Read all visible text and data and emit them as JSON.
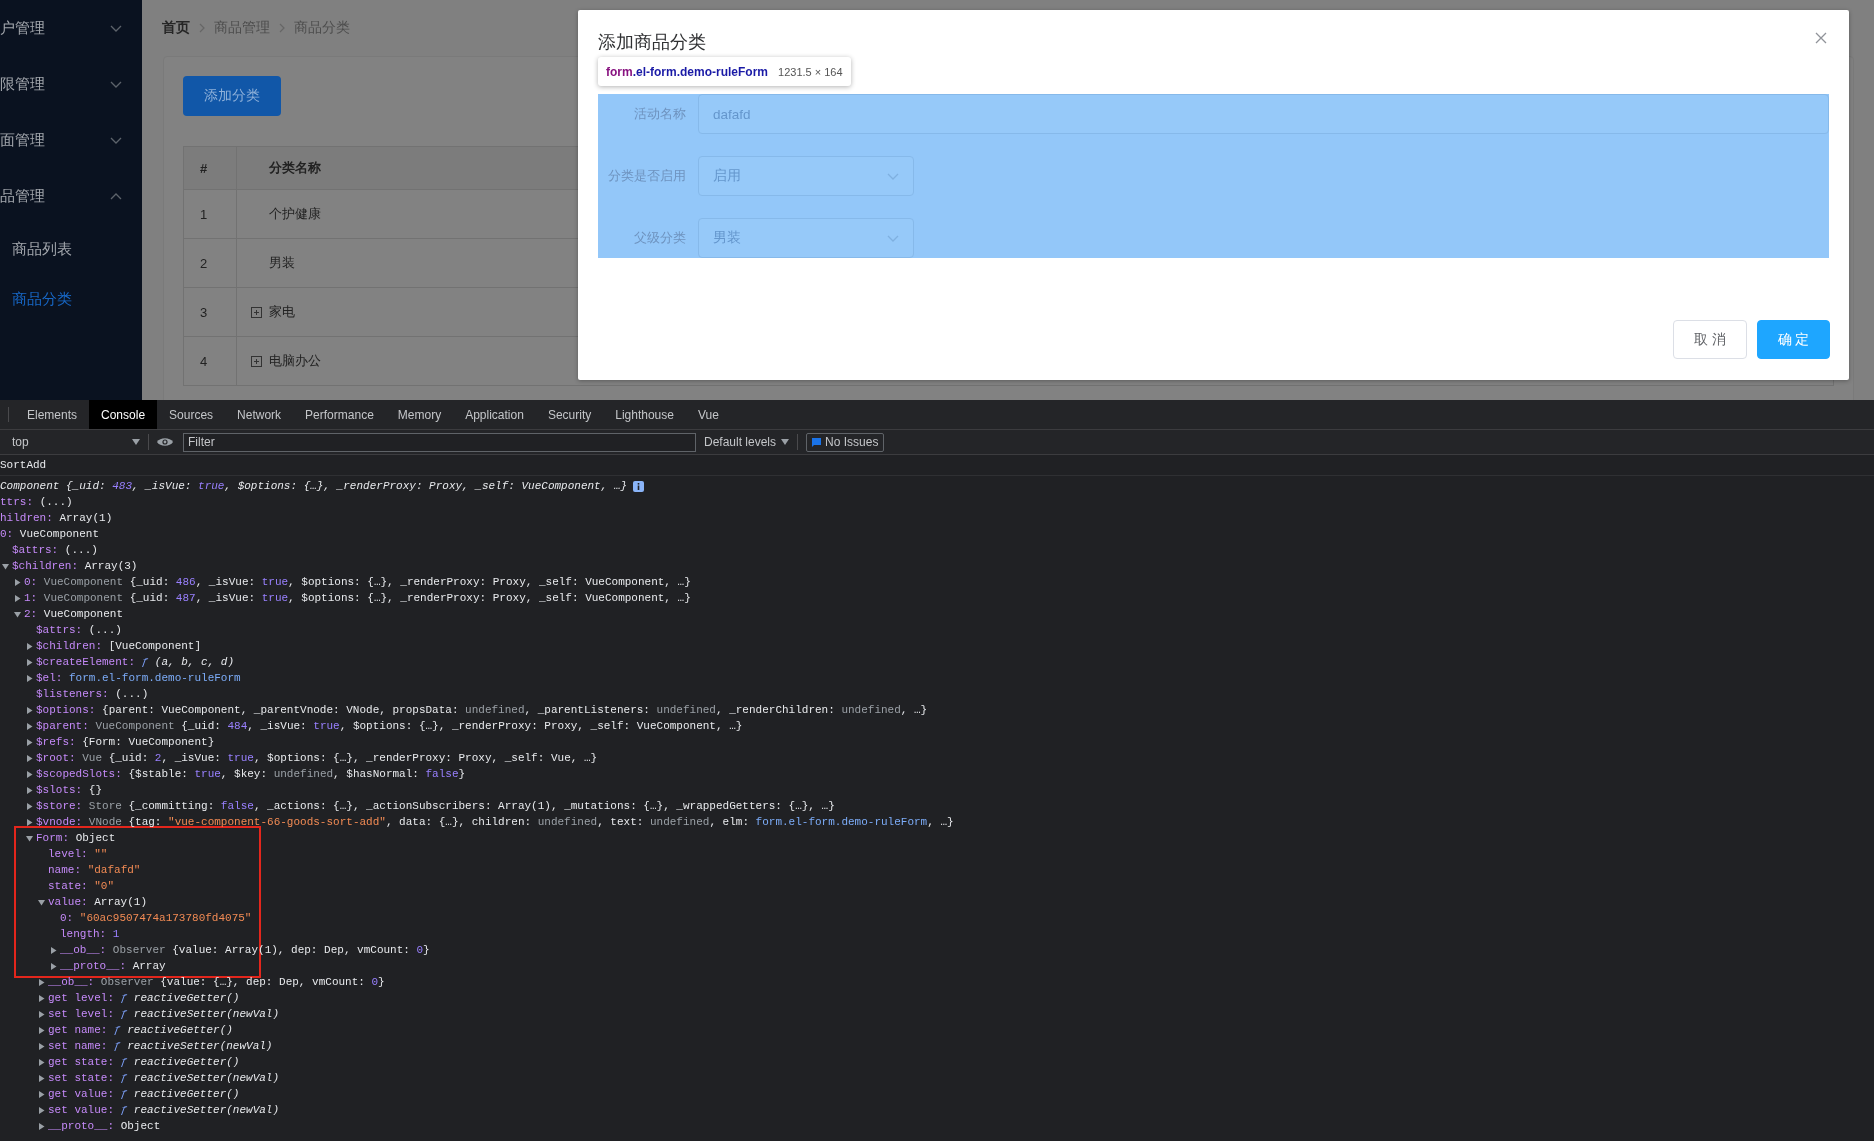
{
  "sidebar": {
    "items": [
      {
        "label": "户管理",
        "kind": "group",
        "expanded": false
      },
      {
        "label": "限管理",
        "kind": "group",
        "expanded": false
      },
      {
        "label": "面管理",
        "kind": "group",
        "expanded": false
      },
      {
        "label": "品管理",
        "kind": "group",
        "expanded": true
      },
      {
        "label": "商品列表",
        "kind": "link",
        "selected": false
      },
      {
        "label": "商品分类",
        "kind": "link",
        "selected": true
      }
    ]
  },
  "breadcrumb": [
    {
      "label": "首页",
      "kind": "link"
    },
    {
      "label": "商品管理",
      "kind": "text"
    },
    {
      "label": "商品分类",
      "kind": "text"
    }
  ],
  "add_button": "添加分类",
  "table": {
    "columns": [
      "#",
      "分类名称"
    ],
    "rows": [
      {
        "index": "1",
        "name": "个护健康",
        "expandable": false
      },
      {
        "index": "2",
        "name": "男装",
        "expandable": false
      },
      {
        "index": "3",
        "name": "家电",
        "expandable": true
      },
      {
        "index": "4",
        "name": "电脑办公",
        "expandable": true
      }
    ]
  },
  "dialog": {
    "title": "添加商品分类",
    "inspector": {
      "tag": "form",
      "classes": ".el-form.demo-ruleForm",
      "size": "1231.5 × 164"
    },
    "fields": [
      {
        "label": "活动名称",
        "kind": "input",
        "value": "dafafd"
      },
      {
        "label": "分类是否启用",
        "kind": "select",
        "value": "启用"
      },
      {
        "label": "父级分类",
        "kind": "select",
        "value": "男装"
      }
    ],
    "buttons": [
      {
        "label": "取 消",
        "kind": "default"
      },
      {
        "label": "确 定",
        "kind": "primary"
      }
    ]
  },
  "devtools": {
    "tabs": [
      {
        "label": "Elements",
        "selected": false
      },
      {
        "label": "Console",
        "selected": true
      },
      {
        "label": "Sources",
        "selected": false
      },
      {
        "label": "Network",
        "selected": false
      },
      {
        "label": "Performance",
        "selected": false
      },
      {
        "label": "Memory",
        "selected": false
      },
      {
        "label": "Application",
        "selected": false
      },
      {
        "label": "Security",
        "selected": false
      },
      {
        "label": "Lighthouse",
        "selected": false
      },
      {
        "label": "Vue",
        "selected": false
      }
    ],
    "context": "top",
    "filter_placeholder": "Filter",
    "levels": "Default levels",
    "issues": "No Issues",
    "log_label": "SortAdd",
    "lines": [
      {
        "value": [
          {
            "kind": "summary",
            "text": "Component {_uid: "
          },
          {
            "kind": "summary_number",
            "text": "483"
          },
          {
            "kind": "summary",
            "text": ", _isVue: "
          },
          {
            "kind": "summary_number",
            "text": "true"
          },
          {
            "kind": "summary",
            "text": ", $options: {…}, _renderProxy: Proxy, _self: VueComponent, …}"
          }
        ],
        "has_info": true
      },
      {
        "key": "ttrs:",
        "value": [
          {
            "kind": "plain",
            "text": "(...)"
          }
        ]
      },
      {
        "key": "hildren:",
        "value": [
          {
            "kind": "plain",
            "text": "Array(1)"
          }
        ]
      },
      {
        "key": "0:",
        "value": [
          {
            "kind": "plain",
            "text": "VueComponent"
          }
        ],
        "children": [
          {
            "key": "$attrs:",
            "value": [
              {
                "kind": "plain",
                "text": "(...)"
              }
            ]
          },
          {
            "key": "$children:",
            "value": [
              {
                "kind": "plain",
                "text": "Array(3)"
              }
            ],
            "expanded": true,
            "children": [
              {
                "key": "0:",
                "value": [
                  {
                    "kind": "dim",
                    "text": "VueComponent "
                  },
                  {
                    "kind": "plain",
                    "text": "{_uid: "
                  },
                  {
                    "kind": "number",
                    "text": "486"
                  },
                  {
                    "kind": "plain",
                    "text": ", _isVue: "
                  },
                  {
                    "kind": "number",
                    "text": "true"
                  },
                  {
                    "kind": "plain",
                    "text": ", $options: {…}, _renderProxy: Proxy, _self: VueComponent, …}"
                  }
                ],
                "expanded": false
              },
              {
                "key": "1:",
                "value": [
                  {
                    "kind": "dim",
                    "text": "VueComponent "
                  },
                  {
                    "kind": "plain",
                    "text": "{_uid: "
                  },
                  {
                    "kind": "number",
                    "text": "487"
                  },
                  {
                    "kind": "plain",
                    "text": ", _isVue: "
                  },
                  {
                    "kind": "number",
                    "text": "true"
                  },
                  {
                    "kind": "plain",
                    "text": ", $options: {…}, _renderProxy: Proxy, _self: VueComponent, …}"
                  }
                ],
                "expanded": false
              },
              {
                "key": "2:",
                "value": [
                  {
                    "kind": "plain",
                    "text": "VueComponent"
                  }
                ],
                "expanded": true,
                "children": [
                  {
                    "key": "$attrs:",
                    "value": [
                      {
                        "kind": "plain",
                        "text": "(...)"
                      }
                    ]
                  },
                  {
                    "key": "$children:",
                    "value": [
                      {
                        "kind": "plain",
                        "text": "[VueComponent]"
                      }
                    ],
                    "expanded": false
                  },
                  {
                    "key": "$createElement:",
                    "value": [
                      {
                        "kind": "func",
                        "text": "ƒ"
                      },
                      {
                        "kind": "italic",
                        "text": " (a, b, c, d)"
                      }
                    ],
                    "expanded": false
                  },
                  {
                    "key": "$el:",
                    "value": [
                      {
                        "kind": "link",
                        "text": "form.el-form.demo-ruleForm"
                      }
                    ],
                    "expanded": false
                  },
                  {
                    "key": "$listeners:",
                    "value": [
                      {
                        "kind": "plain",
                        "text": "(...)"
                      }
                    ]
                  },
                  {
                    "key": "$options:",
                    "value": [
                      {
                        "kind": "plain",
                        "text": "{parent: VueComponent, _parentVnode: VNode, propsData: "
                      },
                      {
                        "kind": "dim",
                        "text": "undefined"
                      },
                      {
                        "kind": "plain",
                        "text": ", _parentListeners: "
                      },
                      {
                        "kind": "dim",
                        "text": "undefined"
                      },
                      {
                        "kind": "plain",
                        "text": ", _renderChildren: "
                      },
                      {
                        "kind": "dim",
                        "text": "undefined"
                      },
                      {
                        "kind": "plain",
                        "text": ", …}"
                      }
                    ],
                    "expanded": false
                  },
                  {
                    "key": "$parent:",
                    "value": [
                      {
                        "kind": "dim",
                        "text": "VueComponent "
                      },
                      {
                        "kind": "plain",
                        "text": "{_uid: "
                      },
                      {
                        "kind": "number",
                        "text": "484"
                      },
                      {
                        "kind": "plain",
                        "text": ", _isVue: "
                      },
                      {
                        "kind": "number",
                        "text": "true"
                      },
                      {
                        "kind": "plain",
                        "text": ", $options: {…}, _renderProxy: Proxy, _self: VueComponent, …}"
                      }
                    ],
                    "expanded": false
                  },
                  {
                    "key": "$refs:",
                    "value": [
                      {
                        "kind": "plain",
                        "text": "{Form: VueComponent}"
                      }
                    ],
                    "expanded": false
                  },
                  {
                    "key": "$root:",
                    "value": [
                      {
                        "kind": "dim",
                        "text": "Vue "
                      },
                      {
                        "kind": "plain",
                        "text": "{_uid: "
                      },
                      {
                        "kind": "number",
                        "text": "2"
                      },
                      {
                        "kind": "plain",
                        "text": ", _isVue: "
                      },
                      {
                        "kind": "number",
                        "text": "true"
                      },
                      {
                        "kind": "plain",
                        "text": ", $options: {…}, _renderProxy: Proxy, _self: Vue, …}"
                      }
                    ],
                    "expanded": false
                  },
                  {
                    "key": "$scopedSlots:",
                    "value": [
                      {
                        "kind": "plain",
                        "text": "{$stable: "
                      },
                      {
                        "kind": "number",
                        "text": "true"
                      },
                      {
                        "kind": "plain",
                        "text": ", $key: "
                      },
                      {
                        "kind": "dim",
                        "text": "undefined"
                      },
                      {
                        "kind": "plain",
                        "text": ", $hasNormal: "
                      },
                      {
                        "kind": "number",
                        "text": "false"
                      },
                      {
                        "kind": "plain",
                        "text": "}"
                      }
                    ],
                    "expanded": false
                  },
                  {
                    "key": "$slots:",
                    "value": [
                      {
                        "kind": "plain",
                        "text": "{}"
                      }
                    ],
                    "expanded": false
                  },
                  {
                    "key": "$store:",
                    "value": [
                      {
                        "kind": "dim",
                        "text": "Store "
                      },
                      {
                        "kind": "plain",
                        "text": "{_committing: "
                      },
                      {
                        "kind": "number",
                        "text": "false"
                      },
                      {
                        "kind": "plain",
                        "text": ", _actions: {…}, _actionSubscribers: Array(1), _mutations: {…}, _wrappedGetters: {…}, …}"
                      }
                    ],
                    "expanded": false
                  },
                  {
                    "key": "$vnode:",
                    "value": [
                      {
                        "kind": "dim",
                        "text": "VNode "
                      },
                      {
                        "kind": "plain",
                        "text": "{tag: "
                      },
                      {
                        "kind": "string",
                        "text": "\"vue-component-66-goods-sort-add\""
                      },
                      {
                        "kind": "plain",
                        "text": ", data: {…}, children: "
                      },
                      {
                        "kind": "dim",
                        "text": "undefined"
                      },
                      {
                        "kind": "plain",
                        "text": ", text: "
                      },
                      {
                        "kind": "dim",
                        "text": "undefined"
                      },
                      {
                        "kind": "plain",
                        "text": ", elm: "
                      },
                      {
                        "kind": "link",
                        "text": "form.el-form.demo-ruleForm"
                      },
                      {
                        "kind": "plain",
                        "text": ", …}"
                      }
                    ],
                    "expanded": false
                  },
                  {
                    "key": "Form:",
                    "value": [
                      {
                        "kind": "plain",
                        "text": "Object"
                      }
                    ],
                    "expanded": true,
                    "boxed": true,
                    "children": [
                      {
                        "key": "level:",
                        "value": [
                          {
                            "kind": "string",
                            "text": "\"\""
                          }
                        ],
                        "boxed": true
                      },
                      {
                        "key": "name:",
                        "value": [
                          {
                            "kind": "string",
                            "text": "\"dafafd\""
                          }
                        ],
                        "boxed": true
                      },
                      {
                        "key": "state:",
                        "value": [
                          {
                            "kind": "string",
                            "text": "\"0\""
                          }
                        ],
                        "boxed": true
                      },
                      {
                        "key": "value:",
                        "value": [
                          {
                            "kind": "plain",
                            "text": "Array(1)"
                          }
                        ],
                        "expanded": true,
                        "boxed": true,
                        "children": [
                          {
                            "key": "0:",
                            "value": [
                              {
                                "kind": "string",
                                "text": "\"60ac9507474a173780fd4075\""
                              }
                            ],
                            "boxed": true
                          },
                          {
                            "key": "length:",
                            "value": [
                              {
                                "kind": "number",
                                "text": "1"
                              }
                            ],
                            "boxed": true
                          },
                          {
                            "key": "__ob__:",
                            "value": [
                              {
                                "kind": "dim",
                                "text": "Observer "
                              },
                              {
                                "kind": "plain",
                                "text": "{value: Array(1), dep: Dep, vmCount: "
                              },
                              {
                                "kind": "number",
                                "text": "0"
                              },
                              {
                                "kind": "plain",
                                "text": "}"
                              }
                            ],
                            "expanded": false,
                            "boxed": true
                          },
                          {
                            "key": "__proto__:",
                            "value": [
                              {
                                "kind": "plain",
                                "text": "Array"
                              }
                            ],
                            "expanded": false,
                            "boxed": true
                          }
                        ]
                      },
                      {
                        "key": "__ob__:",
                        "value": [
                          {
                            "kind": "dim",
                            "text": "Observer "
                          },
                          {
                            "kind": "plain",
                            "text": "{value: {…}, dep: Dep, vmCount: "
                          },
                          {
                            "kind": "number",
                            "text": "0"
                          },
                          {
                            "kind": "plain",
                            "text": "}"
                          }
                        ],
                        "expanded": false
                      },
                      {
                        "key": "get level:",
                        "value": [
                          {
                            "kind": "func",
                            "text": "ƒ"
                          },
                          {
                            "kind": "italic",
                            "text": " reactiveGetter()"
                          }
                        ],
                        "expanded": false
                      },
                      {
                        "key": "set level:",
                        "value": [
                          {
                            "kind": "func",
                            "text": "ƒ"
                          },
                          {
                            "kind": "italic",
                            "text": " reactiveSetter(newVal)"
                          }
                        ],
                        "expanded": false
                      },
                      {
                        "key": "get name:",
                        "value": [
                          {
                            "kind": "func",
                            "text": "ƒ"
                          },
                          {
                            "kind": "italic",
                            "text": " reactiveGetter()"
                          }
                        ],
                        "expanded": false
                      },
                      {
                        "key": "set name:",
                        "value": [
                          {
                            "kind": "func",
                            "text": "ƒ"
                          },
                          {
                            "kind": "italic",
                            "text": " reactiveSetter(newVal)"
                          }
                        ],
                        "expanded": false
                      },
                      {
                        "key": "get state:",
                        "value": [
                          {
                            "kind": "func",
                            "text": "ƒ"
                          },
                          {
                            "kind": "italic",
                            "text": " reactiveGetter()"
                          }
                        ],
                        "expanded": false
                      },
                      {
                        "key": "set state:",
                        "value": [
                          {
                            "kind": "func",
                            "text": "ƒ"
                          },
                          {
                            "kind": "italic",
                            "text": " reactiveSetter(newVal)"
                          }
                        ],
                        "expanded": false
                      },
                      {
                        "key": "get value:",
                        "value": [
                          {
                            "kind": "func",
                            "text": "ƒ"
                          },
                          {
                            "kind": "italic",
                            "text": " reactiveGetter()"
                          }
                        ],
                        "expanded": false
                      },
                      {
                        "key": "set value:",
                        "value": [
                          {
                            "kind": "func",
                            "text": "ƒ"
                          },
                          {
                            "kind": "italic",
                            "text": " reactiveSetter(newVal)"
                          }
                        ],
                        "expanded": false
                      },
                      {
                        "key": "__proto__:",
                        "value": [
                          {
                            "kind": "plain",
                            "text": "Object"
                          }
                        ],
                        "expanded": false
                      }
                    ]
                  }
                ]
              }
            ]
          }
        ]
      }
    ]
  }
}
